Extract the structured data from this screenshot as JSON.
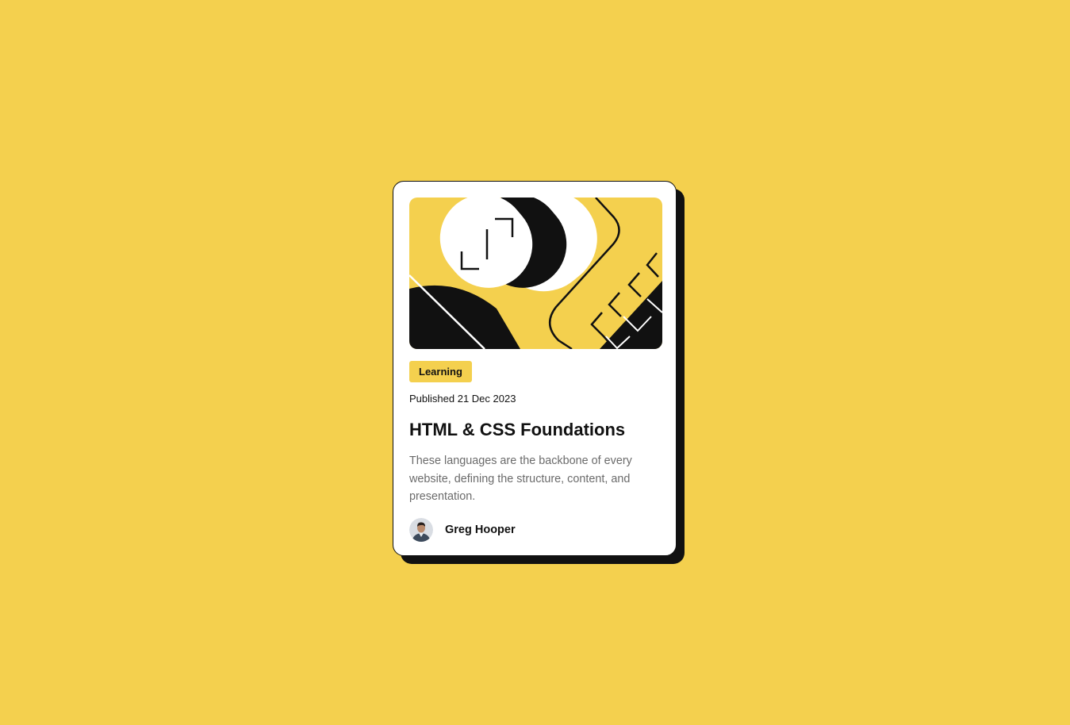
{
  "card": {
    "tag": "Learning",
    "published": "Published 21 Dec 2023",
    "title": "HTML & CSS Foundations",
    "description": "These languages are the backbone of every website, defining the structure, content, and presentation.",
    "author": {
      "name": "Greg Hooper",
      "avatar_icon": "avatar-photo"
    },
    "hero_icon": "abstract-illustration"
  },
  "colors": {
    "background": "#f4d04e",
    "card": "#ffffff",
    "ink": "#111111",
    "muted_text": "#6b6b6b"
  }
}
